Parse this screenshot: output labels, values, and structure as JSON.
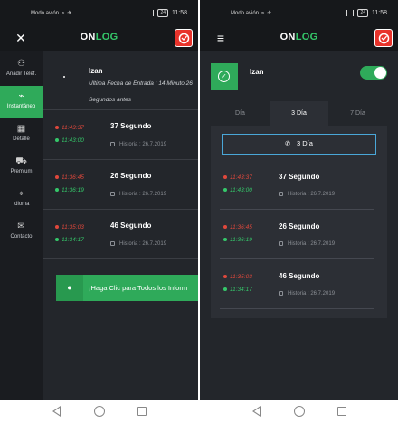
{
  "status": {
    "left_text": "Modo avión",
    "battery": "24",
    "time": "11:58"
  },
  "brand": {
    "logo_white": "ON",
    "logo_green": "LOG"
  },
  "screen1": {
    "sidebar": [
      {
        "label": "Añadir Teléf.",
        "icon": "add-user-icon"
      },
      {
        "label": "Instantáneo",
        "icon": "pulse-icon"
      },
      {
        "label": "Detalle",
        "icon": "calendar-icon"
      },
      {
        "label": "Premium",
        "icon": "cart-icon"
      },
      {
        "label": "Idioma",
        "icon": "location-icon"
      },
      {
        "label": "Contacto",
        "icon": "mail-icon"
      }
    ],
    "profile": {
      "name": "Izan",
      "last_entry": "Última Fecha de Entrada : 14 Minuto 26",
      "since": "Segundos antes"
    },
    "records": [
      {
        "out": "11:43:37",
        "in": "11:43:00",
        "duration": "37 Segundo",
        "history": "Historia : 26.7.2019"
      },
      {
        "out": "11:36:45",
        "in": "11:36:19",
        "duration": "26 Segundo",
        "history": "Historia : 26.7.2019"
      },
      {
        "out": "11:35:03",
        "in": "11:34:17",
        "duration": "46 Segundo",
        "history": "Historia : 26.7.2019"
      }
    ],
    "cta": "¡Haga Clic para Todos los Inform"
  },
  "screen2": {
    "name": "Izan",
    "tabs": [
      "Día",
      "3 Día",
      "7 Día"
    ],
    "active_tab": "3 Día",
    "call_button": "3 Día",
    "records": [
      {
        "out": "11:43:37",
        "in": "11:43:00",
        "duration": "37 Segundo",
        "history": "Historia : 26.7.2019"
      },
      {
        "out": "11:36:45",
        "in": "11:36:19",
        "duration": "26 Segundo",
        "history": "Historia : 26.7.2019"
      },
      {
        "out": "11:35:03",
        "in": "11:34:17",
        "duration": "46 Segundo",
        "history": "Historia : 26.7.2019"
      }
    ]
  },
  "colors": {
    "accent": "#2faa5a",
    "out_time": "#e0483c",
    "in_time": "#35c86a",
    "button_border": "#4aa7d8"
  }
}
